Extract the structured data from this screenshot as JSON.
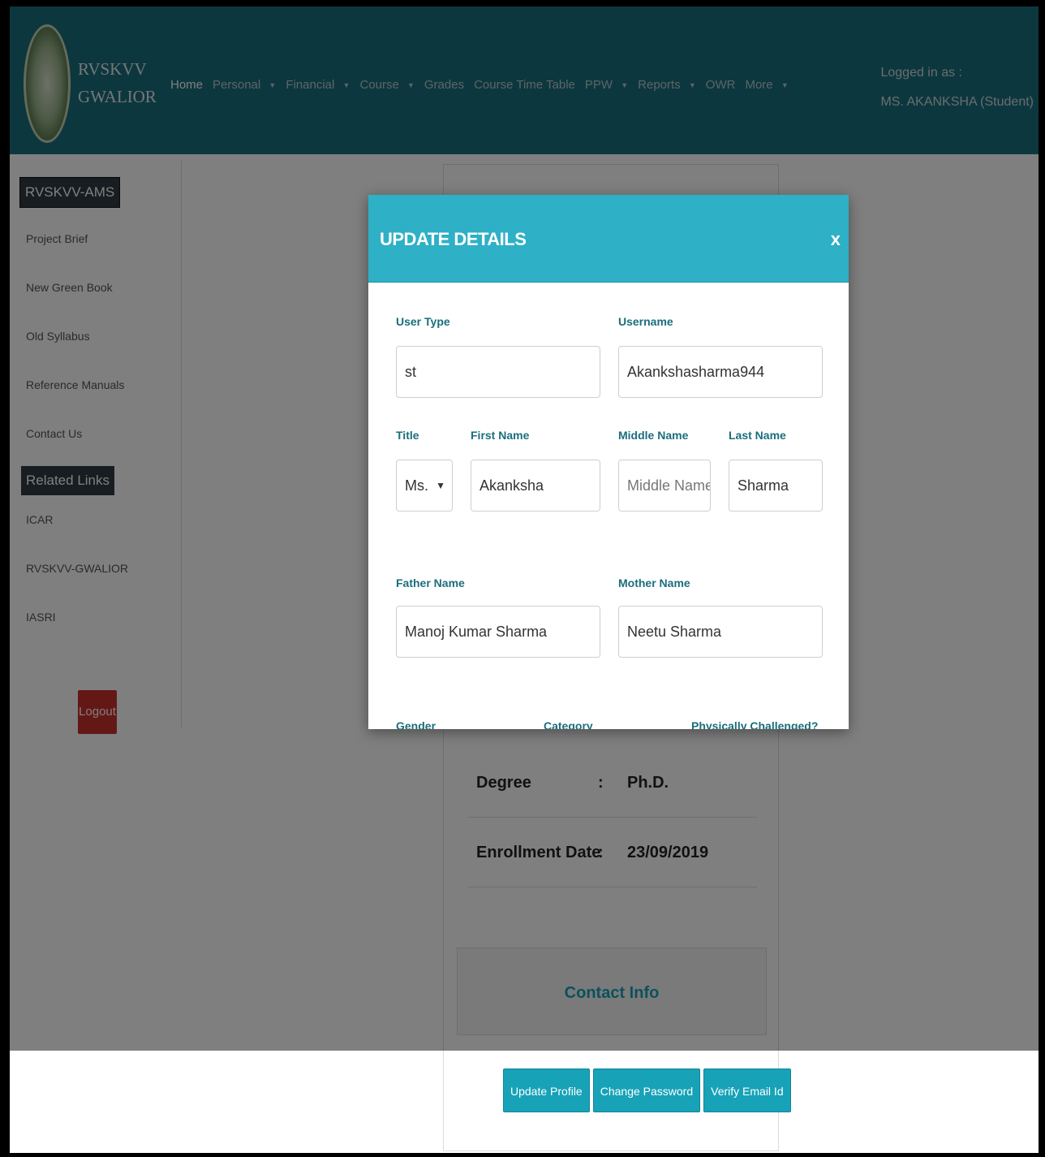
{
  "header": {
    "brand_line1": "RVSKVV",
    "brand_line2": "GWALIOR",
    "nav": [
      {
        "label": "Home",
        "caret": false
      },
      {
        "label": "Personal",
        "caret": true
      },
      {
        "label": "Financial",
        "caret": true
      },
      {
        "label": "Course",
        "caret": true
      },
      {
        "label": "Grades",
        "caret": false
      },
      {
        "label": "Course Time Table",
        "caret": false
      },
      {
        "label": "PPW",
        "caret": true
      },
      {
        "label": "Reports",
        "caret": true
      },
      {
        "label": "OWR",
        "caret": false
      },
      {
        "label": "More",
        "caret": true
      }
    ],
    "logged_in_label": "Logged in as :",
    "logged_in_user": "MS. AKANKSHA (Student)"
  },
  "sidebar": {
    "heading": "RVSKVV-AMS",
    "links": [
      "Project Brief",
      "New Green Book",
      "Old Syllabus",
      "Reference Manuals",
      "Contact Us"
    ],
    "related_heading": "Related Links",
    "related_links": [
      "ICAR",
      "RVSKVV-GWALIOR",
      "IASRI"
    ],
    "logout_label": "Logout"
  },
  "profile": {
    "rows": [
      {
        "key": "Degree",
        "colon": ":",
        "value": "Ph.D."
      },
      {
        "key": "Enrollment Date",
        "colon": ":",
        "value": "23/09/2019"
      }
    ],
    "contact_title": "Contact Info"
  },
  "actions": {
    "update_profile": "Update Profile",
    "change_password": "Change Password",
    "verify_email": "Verify Email Id"
  },
  "modal": {
    "title": "UPDATE DETAILS",
    "close": "x",
    "user_type_label": "User Type",
    "user_type_value": "st",
    "username_label": "Username",
    "username_value": "Akankshasharma944",
    "title_label": "Title",
    "title_value": "Ms.",
    "first_name_label": "First Name",
    "first_name_value": "Akanksha",
    "middle_name_label": "Middle Name",
    "middle_name_placeholder": "Middle Name",
    "last_name_label": "Last Name",
    "last_name_value": "Sharma",
    "father_name_label": "Father Name",
    "father_name_value": "Manoj Kumar Sharma",
    "mother_name_label": "Mother Name",
    "mother_name_value": "Neetu Sharma",
    "gender_label": "Gender",
    "category_label": "Category",
    "physically_challenged_label": "Physically Challenged?"
  },
  "colors": {
    "header_bg": "#1b6e7d",
    "modal_header_bg": "#2eb0c6",
    "button_bg": "#17a2b8",
    "logout_bg": "#c9302c"
  }
}
